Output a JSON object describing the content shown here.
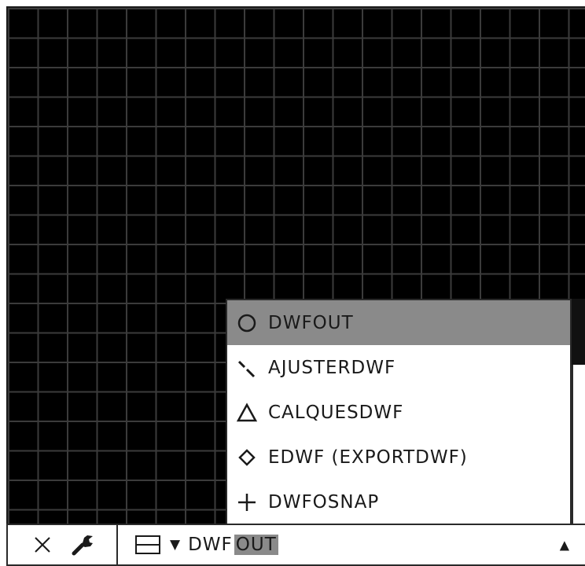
{
  "suggestions": [
    {
      "label": "DWFOUT",
      "icon": "circle-icon",
      "selected": true
    },
    {
      "label": "AJUSTERDWF",
      "icon": "dashed-diagonal-icon",
      "selected": false
    },
    {
      "label": "CALQUESDWF",
      "icon": "triangle-icon",
      "selected": false
    },
    {
      "label": "EDWF (EXPORTDWF)",
      "icon": "diamond-icon",
      "selected": false
    },
    {
      "label": "DWFOSNAP",
      "icon": "plus-icon",
      "selected": false
    }
  ],
  "commandline": {
    "typed": "DWF",
    "completion": "OUT",
    "history_caret": "▼",
    "expand_caret": "▲"
  },
  "colors": {
    "canvas_bg": "#000000",
    "grid_line": "#3b3b3b",
    "selected_bg": "#8a8a8a"
  }
}
